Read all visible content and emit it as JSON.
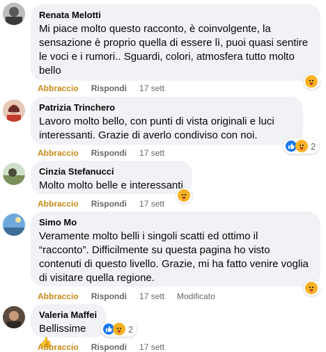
{
  "actions": {
    "like_label": "Abbraccio",
    "reply_label": "Rispondi"
  },
  "comments": [
    {
      "author": "Renata Melotti",
      "text": "Mi piace molto questo racconto, è coinvolgente, la\nsensazione è proprio quella di essere lì, puoi quasi sentire\nle voci e i rumori.. Sguardi, colori, atmosfera tutto molto\nbello",
      "time": "17 sett",
      "reaction_count": ""
    },
    {
      "author": "Patrizia Trinchero",
      "text": "Lavoro molto bello, con punti di vista originali e luci\ninteressanti. Grazie di averlo condiviso con noi.",
      "time": "17 sett",
      "reaction_count": "2"
    },
    {
      "author": "Cinzia Stefanucci",
      "text": "Molto molto belle e interessanti",
      "time": "17 sett",
      "reaction_count": ""
    },
    {
      "author": "Simo Mo",
      "text": "Veramente molto belli i singoli scatti ed ottimo il\n“racconto”. Difficilmente su questa pagina ho visto\ncontenuti di questo livello. Grazie, mi ha fatto venire voglia\ndi visitare quella regione.",
      "time": "17 sett",
      "edited": "Modificato",
      "reaction_count": ""
    },
    {
      "author": "Valeria Maffei",
      "text": "Bellissime 👍",
      "time": "17 sett",
      "reaction_count": "2"
    }
  ],
  "icons": {
    "care_reaction": "care-emoji-icon",
    "like_reaction": "thumbs-up-icon"
  },
  "colors": {
    "bubble_bg": "#f0f2f5",
    "like_action": "#c68a16",
    "meta_gray": "#65676b",
    "like_blue": "#1877f2",
    "care_yellow": "#f7b125"
  }
}
